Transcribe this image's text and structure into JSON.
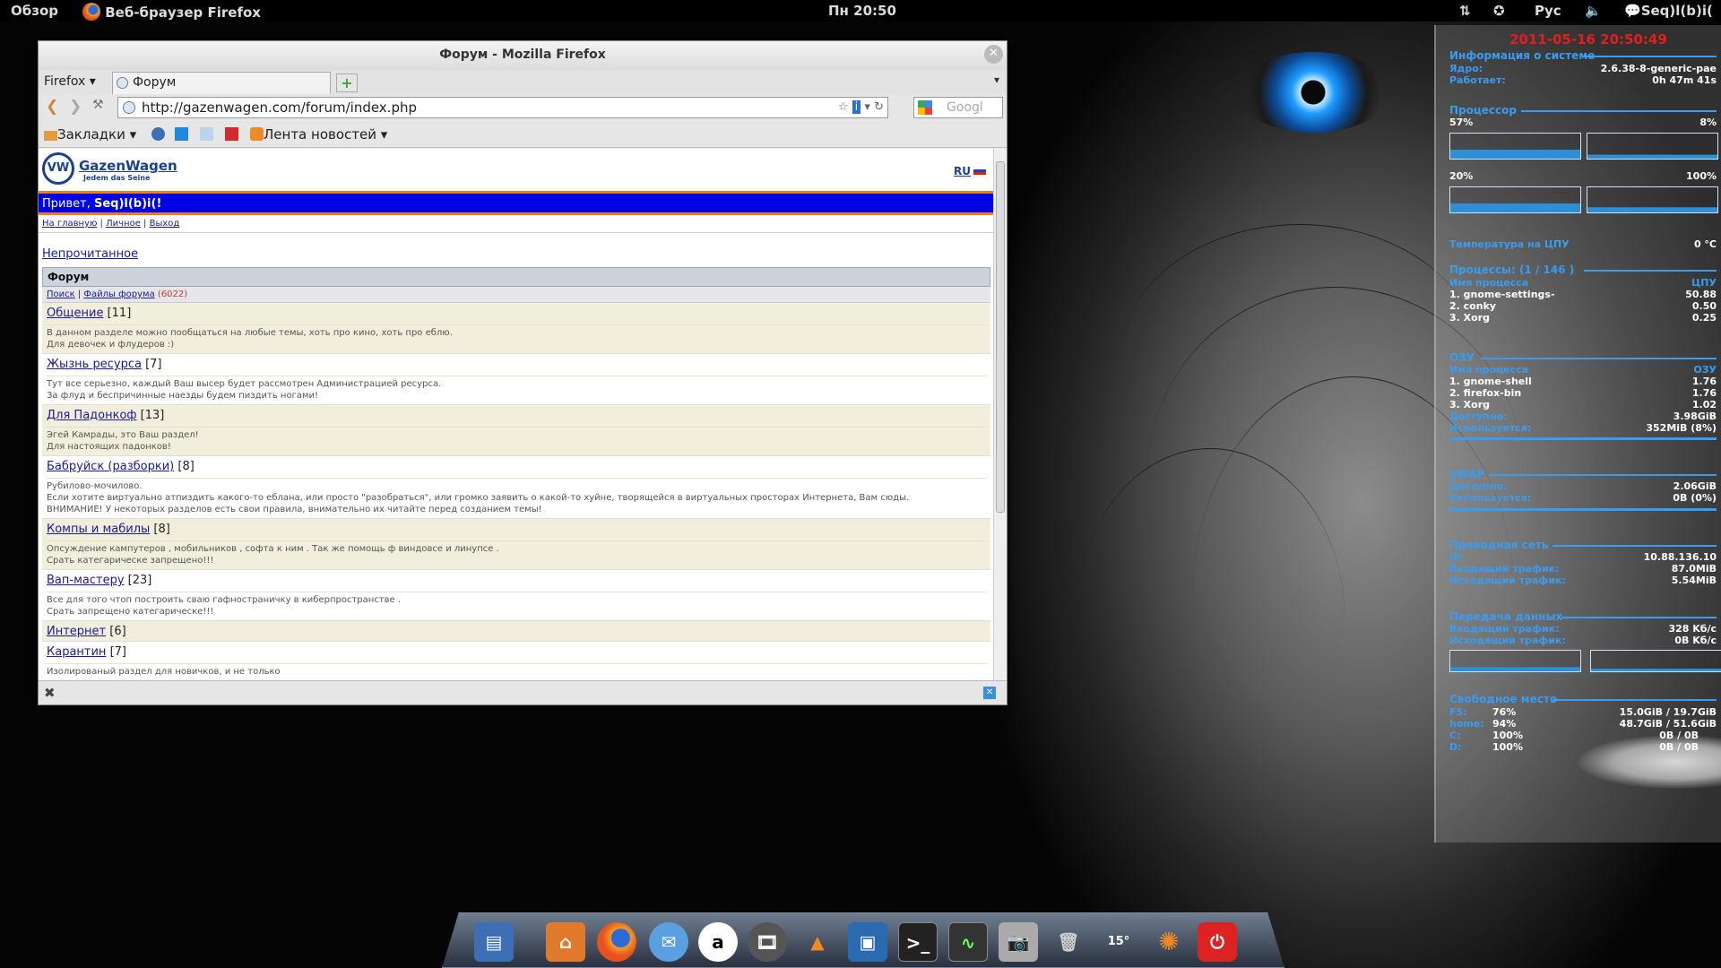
{
  "top_panel": {
    "overview": "Обзор",
    "app_name": "Веб-браузер Firefox",
    "clock": "Пн 20:50",
    "keyboard_layout": "Рус",
    "user": "Seq)l(b)i("
  },
  "browser": {
    "window_title": "Форум - Mozilla Firefox",
    "menu_label": "Firefox",
    "tab_title": "Форум",
    "url": "http://gazenwagen.com/forum/index.php",
    "search_placeholder": "Googl",
    "bookmarks_label": "Закладки",
    "news_feed_label": "Лента новостей"
  },
  "forum": {
    "logo_title": "GazenWagen",
    "logo_subtitle": "Jedem das Seine",
    "lang": "RU",
    "greeting": "Привет, ",
    "greeting_user": "Seq)l(b)i(!",
    "links": [
      "На главную",
      "Личное",
      "Выход"
    ],
    "unread": "Непрочитанное",
    "table_header": "Форум",
    "sub_links": {
      "search": "Поиск",
      "files": "Файлы форума",
      "files_count": "(6022)"
    },
    "sections": [
      {
        "title": "Общение",
        "count": "[11]",
        "desc": [
          "В данном разделе можно пообщаться на любые темы, хоть про кино, хоть про еблю.",
          "Для девочек и флудеров :)"
        ]
      },
      {
        "title": "Жызнь ресурса",
        "count": "[7]",
        "desc": [
          "Тут все серьезно, каждый Ваш высер будет рассмотрен Администрацией ресурса.",
          "За флуд и беспричинные наезды будем пиздить ногами!"
        ]
      },
      {
        "title": "Для Падонкоф",
        "count": "[13]",
        "desc": [
          "Эгей Камрады, это Ваш раздел!",
          "Для настоящих падонков!"
        ]
      },
      {
        "title": "Бабруйск (разборки)",
        "count": "[8]",
        "desc": [
          "Рубилово-мочилово.",
          "Если хотите виртуально атпиздить какого-то еблана, или просто \"разобраться\", или громко заявить о какой-то хуйне, творящейся в виртуальных просторах Интернета, Вам сюды.",
          "ВНИМАНИЕ! У некоторых разделов есть свои правила, внимательно их читайте перед созданием темы!"
        ]
      },
      {
        "title": "Компы и мабилы",
        "count": "[8]",
        "desc": [
          "Опсуждение кампутеров , мобильников , софта к ним . Так же помощь ф виндовсе и линупсе .",
          "Срать категарическе запрещено!!!"
        ]
      },
      {
        "title": "Вап-мастеру",
        "count": "[23]",
        "desc": [
          "Все для того чтоп построить сваю гафностраничку в киберпространстве .",
          "Срать запрещено категарическе!!!"
        ]
      },
      {
        "title": "Интернет",
        "count": "[6]",
        "desc": []
      },
      {
        "title": "Карантин",
        "count": "[7]",
        "desc": [
          "Изолированый раздел для новичков, и не только"
        ]
      }
    ]
  },
  "conky": {
    "datetime": "2011-05-16 20:50:49",
    "sys_title": "Информация о системе",
    "kernel_label": "Ядро:",
    "kernel_value": "2.6.38-8-generic-pae",
    "uptime_label": "Работает:",
    "uptime_value": "0h 47m 41s",
    "cpu_title": "Процессор",
    "cpu1": "57%",
    "cpu2": "8%",
    "cpu3": "20%",
    "cpu4": "100%",
    "temp_label": "Температура на ЦПУ",
    "temp_value": "0 °C",
    "proc_title": "Процессы: (1  / 146 )",
    "proc_col_name": "Имя процесса",
    "proc_col_cpu": "ЦПУ",
    "proc_rows": [
      [
        "1. gnome-settings-",
        "50.88"
      ],
      [
        "2. conky",
        "0.50"
      ],
      [
        "3. Xorg",
        "0.25"
      ]
    ],
    "ram_title": "ОЗУ",
    "ram_col_name": "Имя процесса",
    "ram_col_val": "ОЗУ",
    "ram_rows": [
      [
        "1. gnome-shell",
        "1.76"
      ],
      [
        "2. firefox-bin",
        "1.76"
      ],
      [
        "3. Xorg",
        "1.02"
      ]
    ],
    "ram_avail_label": "Доступно:",
    "ram_avail_value": "3.98GiB",
    "ram_used_label": "Используется:",
    "ram_used_value": "352MiB  (8%)",
    "swap_title": "SWAP",
    "swap_avail_label": "Доступно:",
    "swap_avail_value": "2.06GiB",
    "swap_used_label": "Используется:",
    "swap_used_value": "0B        (0%)",
    "net_title": "Проводная сеть",
    "ip_label": "IP:",
    "ip_value": "10.88.136.10",
    "in_label": "Входящий трафик:",
    "in_value": "87.0MiB",
    "out_label": "Исходящий трафик:",
    "out_value": "5.54MiB",
    "transfer_title": "Передача данных",
    "tin_label": "Входящий трафик:",
    "tin_value": "328     Kб/с",
    "tout_label": "Исходящий трафик:",
    "tout_value": "0B      Kб/с",
    "disk_title": "Свободное место",
    "disks": [
      [
        "FS:",
        "76%",
        "15.0GiB /  19.7GiB"
      ],
      [
        "home:",
        "94%",
        "48.7GiB /  51.6GiB"
      ],
      [
        "C:",
        "100%",
        "0B       / 0B"
      ],
      [
        "D:",
        "100%",
        "0B       / 0B"
      ]
    ]
  },
  "dock": {
    "weather_temp": "15°"
  },
  "colors": {
    "accent": "#3a9cf0",
    "clock": "#e31e1e",
    "forum_bar": "#0000e6",
    "forum_border": "#f07b1b"
  }
}
